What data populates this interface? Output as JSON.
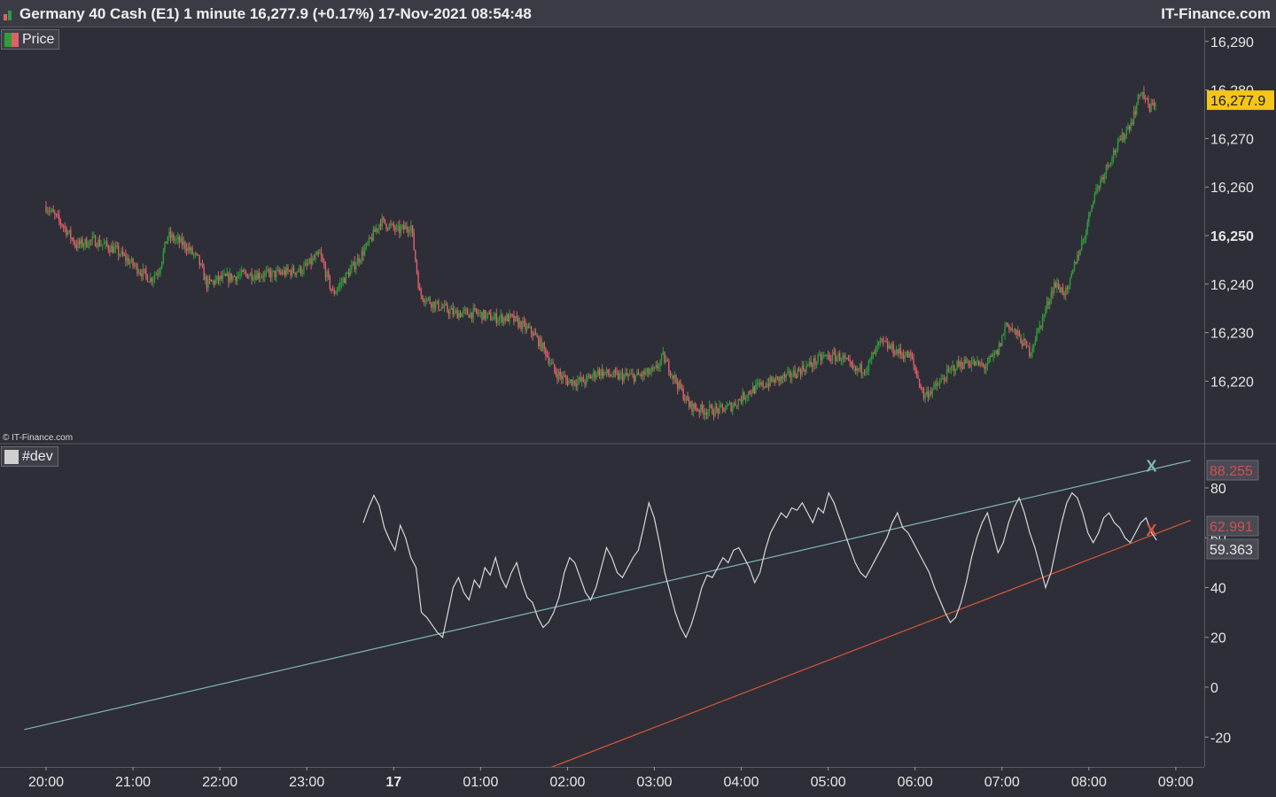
{
  "header": {
    "title": "Germany 40 Cash (E1) 1 minute 16,277.9 (+0.17%) 17-Nov-2021 08:54:48",
    "brand": "IT-Finance.com"
  },
  "price_panel": {
    "label": "Price",
    "copyright": "© IT-Finance.com",
    "current_price_label": "16,277.9",
    "colors": {
      "up": "#2e9e3a",
      "down": "#e0606a",
      "current_tag": "#f5c518"
    }
  },
  "dev_panel": {
    "label": "#dev",
    "markers": [
      "X",
      "X"
    ],
    "value_tags": [
      "88.255",
      "62.991",
      "59.363"
    ],
    "colors": {
      "line": "#d8d8d8",
      "upper_trend": "#7fb6b8",
      "lower_trend": "#d9573a",
      "tag_text_red": "#d05050"
    }
  },
  "chart_data": [
    {
      "type": "candlestick",
      "title": "Germany 40 Cash (E1) 1 minute",
      "ylim": [
        16210,
        16292
      ],
      "y_ticks": [
        "16,290",
        "16,280",
        "16,270",
        "16,260",
        "16,250",
        "16,240",
        "16,230",
        "16,220"
      ],
      "y_tick_values": [
        16290,
        16280,
        16270,
        16260,
        16250,
        16240,
        16230,
        16220
      ],
      "current": 16277.9,
      "x_labels": [
        "20:00",
        "21:00",
        "22:00",
        "23:00",
        "17",
        "01:00",
        "02:00",
        "03:00",
        "04:00",
        "05:00",
        "06:00",
        "07:00",
        "08:00",
        "09:00"
      ],
      "x_label_hours": [
        0,
        1,
        2,
        3,
        4,
        5,
        6,
        7,
        8,
        9,
        10,
        11,
        12,
        13
      ],
      "close_path": [
        [
          0.0,
          16256
        ],
        [
          0.2,
          16252
        ],
        [
          0.35,
          16248
        ],
        [
          0.55,
          16249
        ],
        [
          0.8,
          16247
        ],
        [
          1.0,
          16244
        ],
        [
          1.2,
          16241
        ],
        [
          1.3,
          16243
        ],
        [
          1.4,
          16250
        ],
        [
          1.6,
          16248
        ],
        [
          1.75,
          16245
        ],
        [
          1.85,
          16240
        ],
        [
          2.0,
          16241
        ],
        [
          2.3,
          16242
        ],
        [
          2.6,
          16242
        ],
        [
          2.95,
          16243
        ],
        [
          3.15,
          16246
        ],
        [
          3.3,
          16238
        ],
        [
          3.55,
          16244
        ],
        [
          3.7,
          16248
        ],
        [
          3.85,
          16253
        ],
        [
          4.05,
          16251
        ],
        [
          4.2,
          16252
        ],
        [
          4.3,
          16238
        ],
        [
          4.45,
          16236
        ],
        [
          4.7,
          16234
        ],
        [
          4.95,
          16234
        ],
        [
          5.15,
          16233
        ],
        [
          5.35,
          16233
        ],
        [
          5.6,
          16230
        ],
        [
          5.75,
          16226
        ],
        [
          5.85,
          16222
        ],
        [
          6.0,
          16220
        ],
        [
          6.2,
          16220
        ],
        [
          6.35,
          16222
        ],
        [
          6.55,
          16221
        ],
        [
          6.8,
          16221
        ],
        [
          7.0,
          16222
        ],
        [
          7.1,
          16225
        ],
        [
          7.25,
          16220
        ],
        [
          7.4,
          16215
        ],
        [
          7.55,
          16214
        ],
        [
          7.75,
          16214
        ],
        [
          7.9,
          16215
        ],
        [
          8.1,
          16218
        ],
        [
          8.35,
          16220
        ],
        [
          8.55,
          16221
        ],
        [
          8.75,
          16223
        ],
        [
          8.95,
          16225
        ],
        [
          9.15,
          16225
        ],
        [
          9.3,
          16222
        ],
        [
          9.45,
          16223
        ],
        [
          9.6,
          16228
        ],
        [
          9.8,
          16226
        ],
        [
          9.95,
          16225
        ],
        [
          10.1,
          16217
        ],
        [
          10.25,
          16219
        ],
        [
          10.45,
          16223
        ],
        [
          10.6,
          16224
        ],
        [
          10.8,
          16223
        ],
        [
          10.95,
          16226
        ],
        [
          11.05,
          16232
        ],
        [
          11.2,
          16229
        ],
        [
          11.32,
          16226
        ],
        [
          11.45,
          16232
        ],
        [
          11.6,
          16240
        ],
        [
          11.75,
          16238
        ],
        [
          11.85,
          16245
        ],
        [
          11.95,
          16250
        ],
        [
          12.05,
          16258
        ],
        [
          12.15,
          16262
        ],
        [
          12.25,
          16266
        ],
        [
          12.38,
          16270
        ],
        [
          12.5,
          16274
        ],
        [
          12.6,
          16280
        ],
        [
          12.7,
          16276
        ],
        [
          12.78,
          16278
        ]
      ]
    },
    {
      "type": "line",
      "series_name": "#dev",
      "ylim": [
        -33,
        92
      ],
      "y_ticks": [
        "80",
        "60",
        "40",
        "20",
        "0",
        "-20"
      ],
      "y_tick_values": [
        80,
        60,
        40,
        20,
        0,
        -20
      ],
      "x_start_hour": 3.65,
      "x_end_hour": 12.78,
      "values": [
        66,
        72,
        77,
        73,
        64,
        59,
        55,
        65,
        60,
        52,
        48,
        30,
        28,
        25,
        22,
        20,
        30,
        40,
        44,
        38,
        35,
        43,
        40,
        48,
        45,
        52,
        44,
        40,
        46,
        50,
        42,
        36,
        34,
        28,
        24,
        26,
        30,
        36,
        46,
        52,
        50,
        44,
        38,
        35,
        40,
        48,
        56,
        52,
        46,
        44,
        48,
        52,
        55,
        64,
        74,
        68,
        58,
        46,
        38,
        30,
        24,
        20,
        25,
        32,
        40,
        45,
        44,
        48,
        52,
        50,
        55,
        56,
        52,
        48,
        42,
        46,
        55,
        62,
        66,
        70,
        68,
        72,
        71,
        74,
        70,
        66,
        72,
        70,
        78,
        74,
        68,
        62,
        56,
        50,
        46,
        44,
        48,
        52,
        56,
        60,
        66,
        70,
        64,
        62,
        58,
        54,
        50,
        46,
        40,
        35,
        30,
        26,
        28,
        34,
        42,
        52,
        60,
        66,
        70,
        62,
        54,
        58,
        66,
        72,
        76,
        70,
        62,
        56,
        48,
        40,
        46,
        56,
        66,
        74,
        78,
        76,
        70,
        62,
        58,
        62,
        68,
        70,
        66,
        64,
        60,
        58,
        62,
        66,
        68,
        62,
        59
      ],
      "upper_trendline": [
        [
          -0.25,
          -17
        ],
        [
          13.17,
          91
        ]
      ],
      "lower_trendline": [
        [
          5.75,
          -33
        ],
        [
          13.17,
          67
        ]
      ],
      "marker_values": [
        88.255,
        62.991
      ]
    }
  ]
}
